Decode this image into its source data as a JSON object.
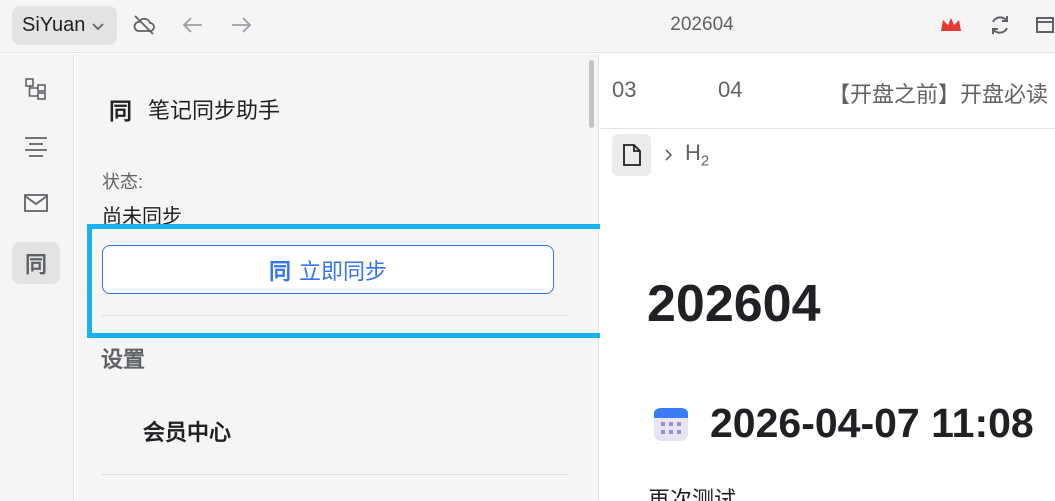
{
  "topbar": {
    "workspace_label": "SiYuan",
    "document_title": "202604",
    "icons": [
      "cloud-off-icon",
      "back-arrow-icon",
      "forward-arrow-icon",
      "crown-icon",
      "sync-icon",
      "window-icon"
    ],
    "crown_color": "#e53935"
  },
  "dock": {
    "items": [
      "outline-tree-icon",
      "align-center-icon",
      "mail-icon",
      "sync-helper-icon"
    ],
    "active_glyph": "同"
  },
  "sync_panel": {
    "icon_glyph": "同",
    "title": "笔记同步助手",
    "status_label": "状态:",
    "status_value": "尚未同步",
    "sync_button_icon": "同",
    "sync_button_label": "立即同步",
    "settings_heading": "设置",
    "member_center": "会员中心",
    "accent_color": "#3573f0",
    "highlight_color": "#1ab0f4"
  },
  "editor": {
    "tabs": [
      "03",
      "04",
      "【开盘之前】开盘必读"
    ],
    "breadcrumb_heading": "H",
    "breadcrumb_heading_sub": "2",
    "heading1": "202604",
    "heading2": "2026-04-07 11:08",
    "paragraph": "再次测试"
  }
}
